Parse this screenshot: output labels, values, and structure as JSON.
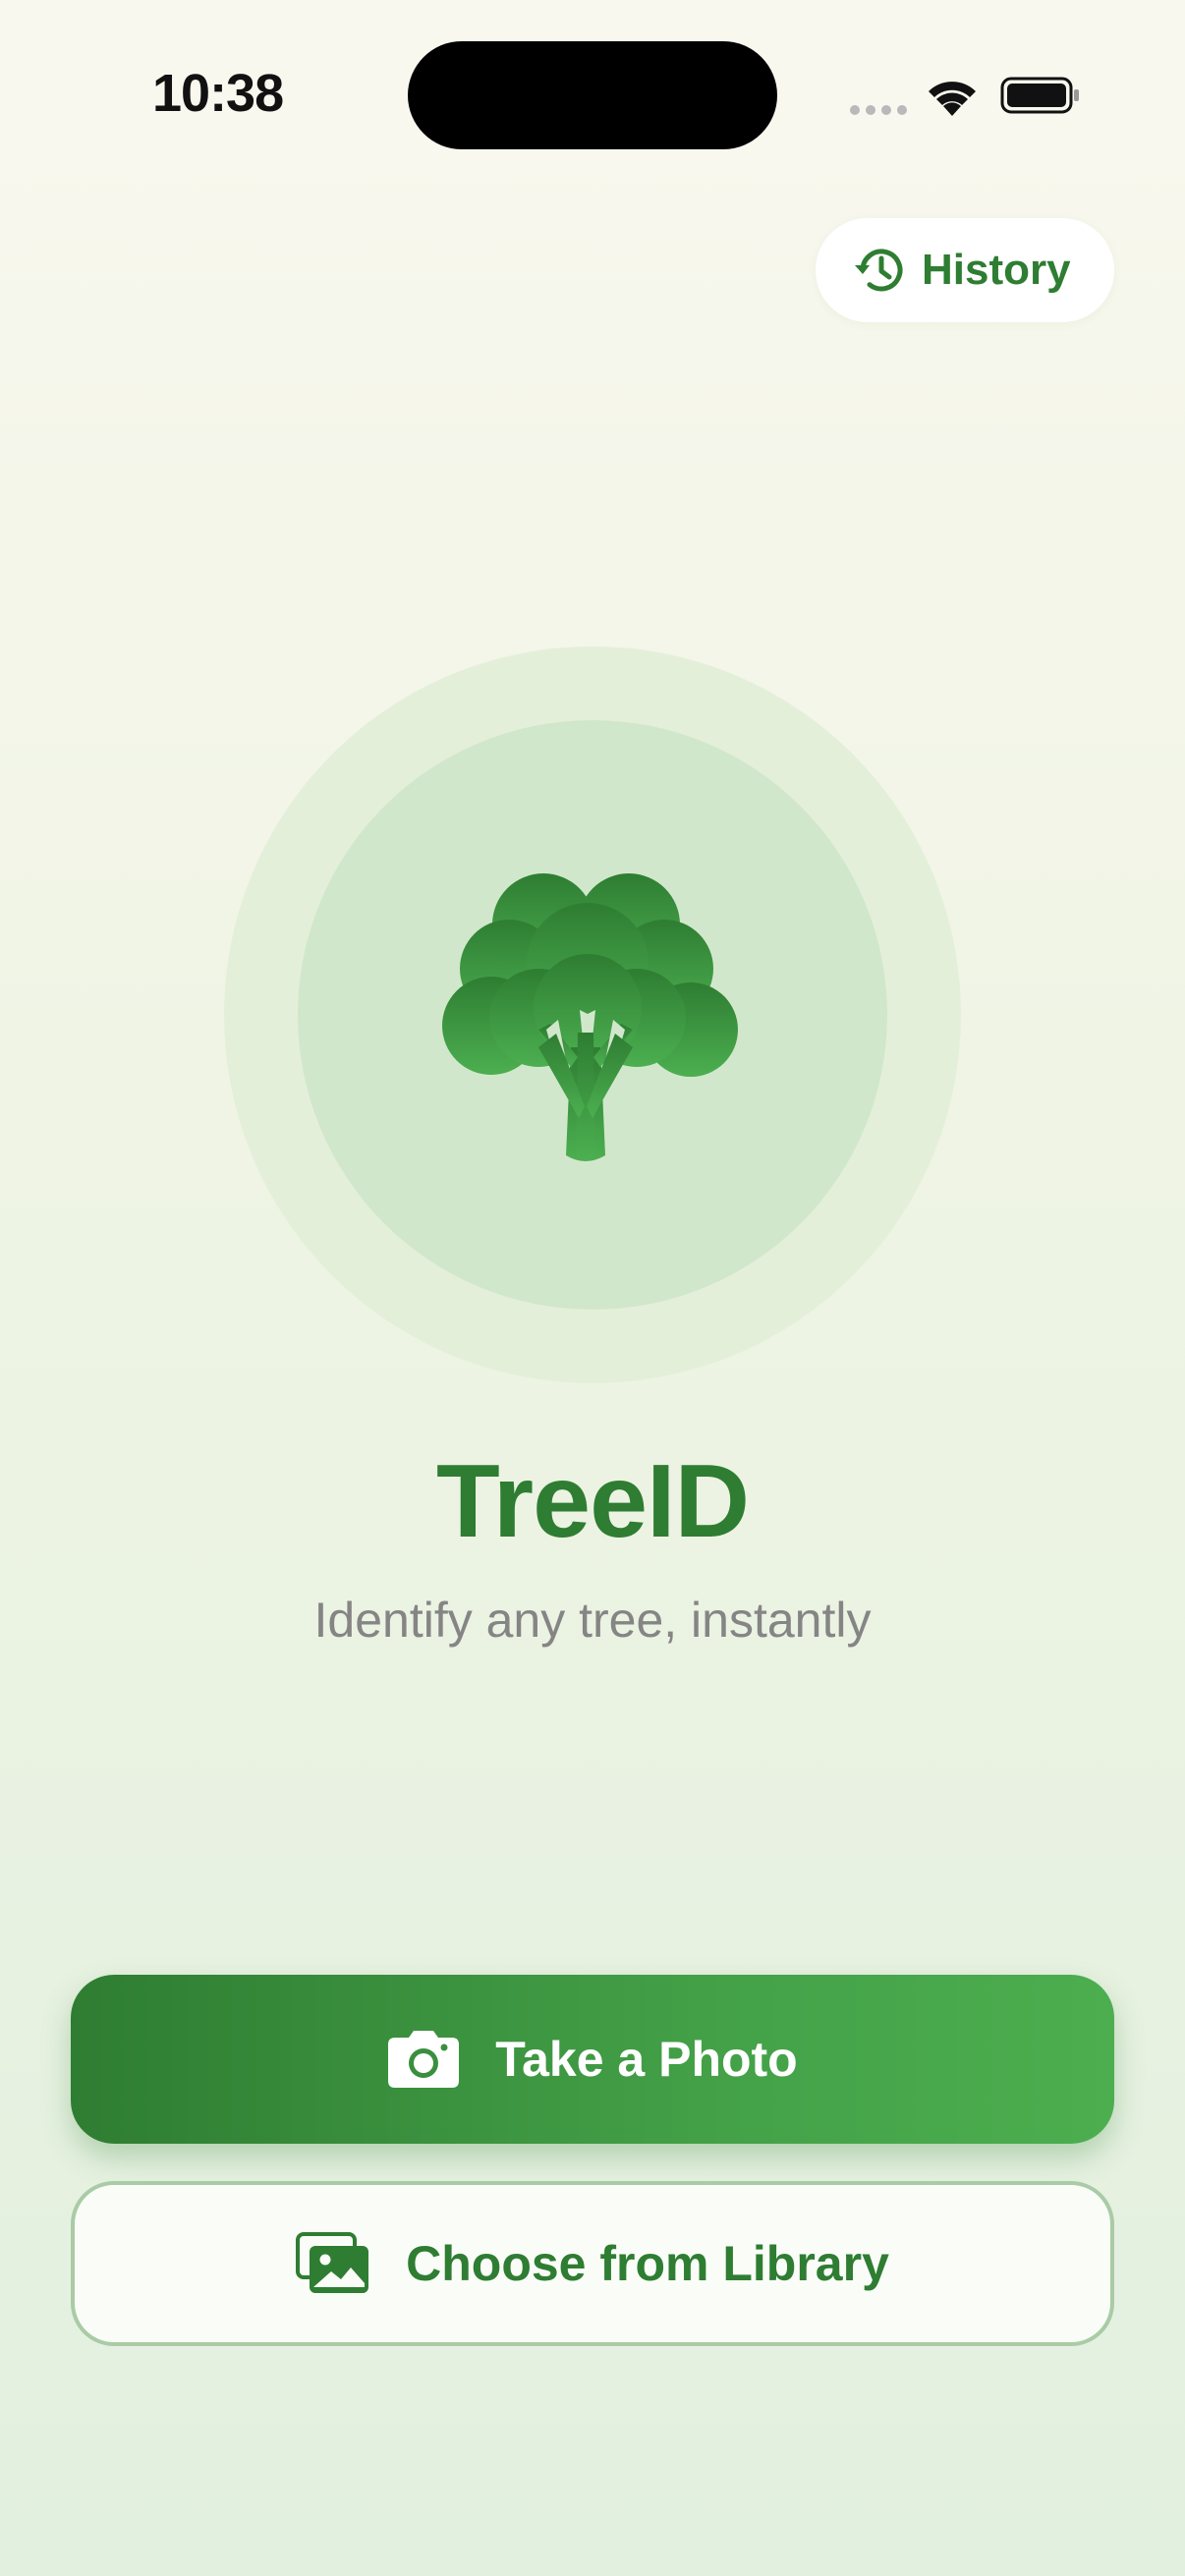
{
  "status_bar": {
    "time": "10:38"
  },
  "header": {
    "history_label": "History",
    "history_icon": "history-clock-icon"
  },
  "hero": {
    "icon": "tree-icon",
    "title": "TreeID",
    "subtitle": "Identify any tree, instantly"
  },
  "actions": {
    "take_photo_label": "Take a Photo",
    "take_photo_icon": "camera-icon",
    "library_label": "Choose from Library",
    "library_icon": "photo-library-icon"
  },
  "colors": {
    "brand_green": "#2e7d32",
    "accent_green": "#4caf50",
    "subtitle_gray": "#858585"
  }
}
